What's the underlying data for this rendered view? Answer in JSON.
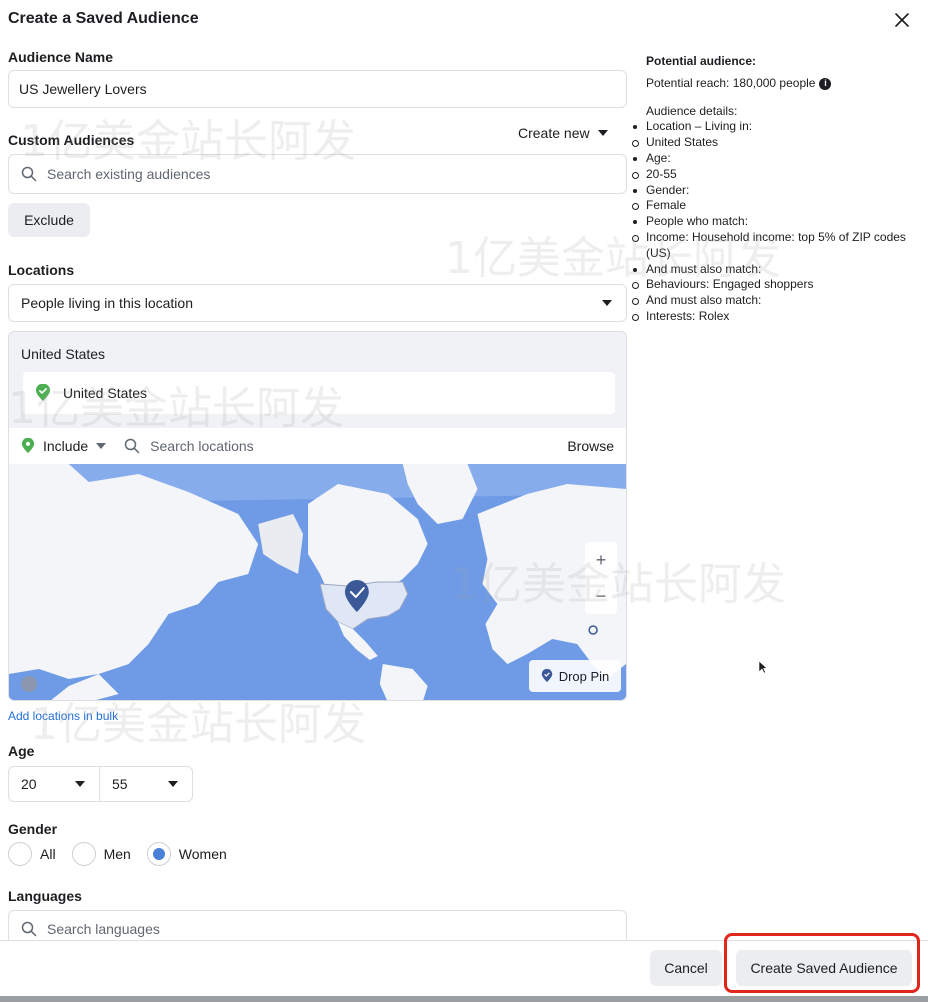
{
  "dialog": {
    "title": "Create a Saved Audience"
  },
  "audience_name": {
    "label": "Audience Name",
    "value": "US Jewellery Lovers"
  },
  "custom_audiences": {
    "label": "Custom Audiences",
    "create_new_label": "Create new",
    "search_placeholder": "Search existing audiences",
    "exclude_label": "Exclude"
  },
  "locations": {
    "label": "Locations",
    "mode_selected": "People living in this location",
    "group_title": "United States",
    "chips": [
      {
        "name": "United States"
      }
    ],
    "include_label": "Include",
    "search_placeholder": "Search locations",
    "browse_label": "Browse",
    "drop_pin_label": "Drop Pin",
    "bulk_link": "Add locations in bulk"
  },
  "age": {
    "label": "Age",
    "min": "20",
    "max": "55"
  },
  "gender": {
    "label": "Gender",
    "options": [
      {
        "label": "All",
        "selected": false
      },
      {
        "label": "Men",
        "selected": false
      },
      {
        "label": "Women",
        "selected": true
      }
    ]
  },
  "languages": {
    "label": "Languages",
    "search_placeholder": "Search languages"
  },
  "footer": {
    "cancel_label": "Cancel",
    "create_label": "Create Saved Audience"
  },
  "summary": {
    "title": "Potential audience:",
    "reach": "Potential reach: 180,000 people",
    "details_title": "Audience details:",
    "items": [
      {
        "text": "Location – Living in:",
        "bullet": "disc"
      },
      {
        "text": "United States",
        "bullet": "circle"
      },
      {
        "text": "Age:",
        "bullet": "disc"
      },
      {
        "text": "20-55",
        "bullet": "circle"
      },
      {
        "text": "Gender:",
        "bullet": "disc"
      },
      {
        "text": "Female",
        "bullet": "circle"
      },
      {
        "text": "People who match:",
        "bullet": "disc"
      },
      {
        "text": "Income: Household income: top 5% of ZIP codes (US)",
        "bullet": "circle"
      },
      {
        "text": "And must also match:",
        "bullet": "disc"
      },
      {
        "text": "Behaviours: Engaged shoppers",
        "bullet": "circle"
      },
      {
        "text": "And must also match:",
        "bullet": "circle"
      },
      {
        "text": "Interests: Rolex",
        "bullet": "circle"
      }
    ]
  },
  "watermark": "1亿美金站长阿发",
  "colors": {
    "accent": "#4a80d8",
    "link": "#216fdb",
    "highlight": "#e0261b",
    "pin_green": "#4caf50"
  }
}
